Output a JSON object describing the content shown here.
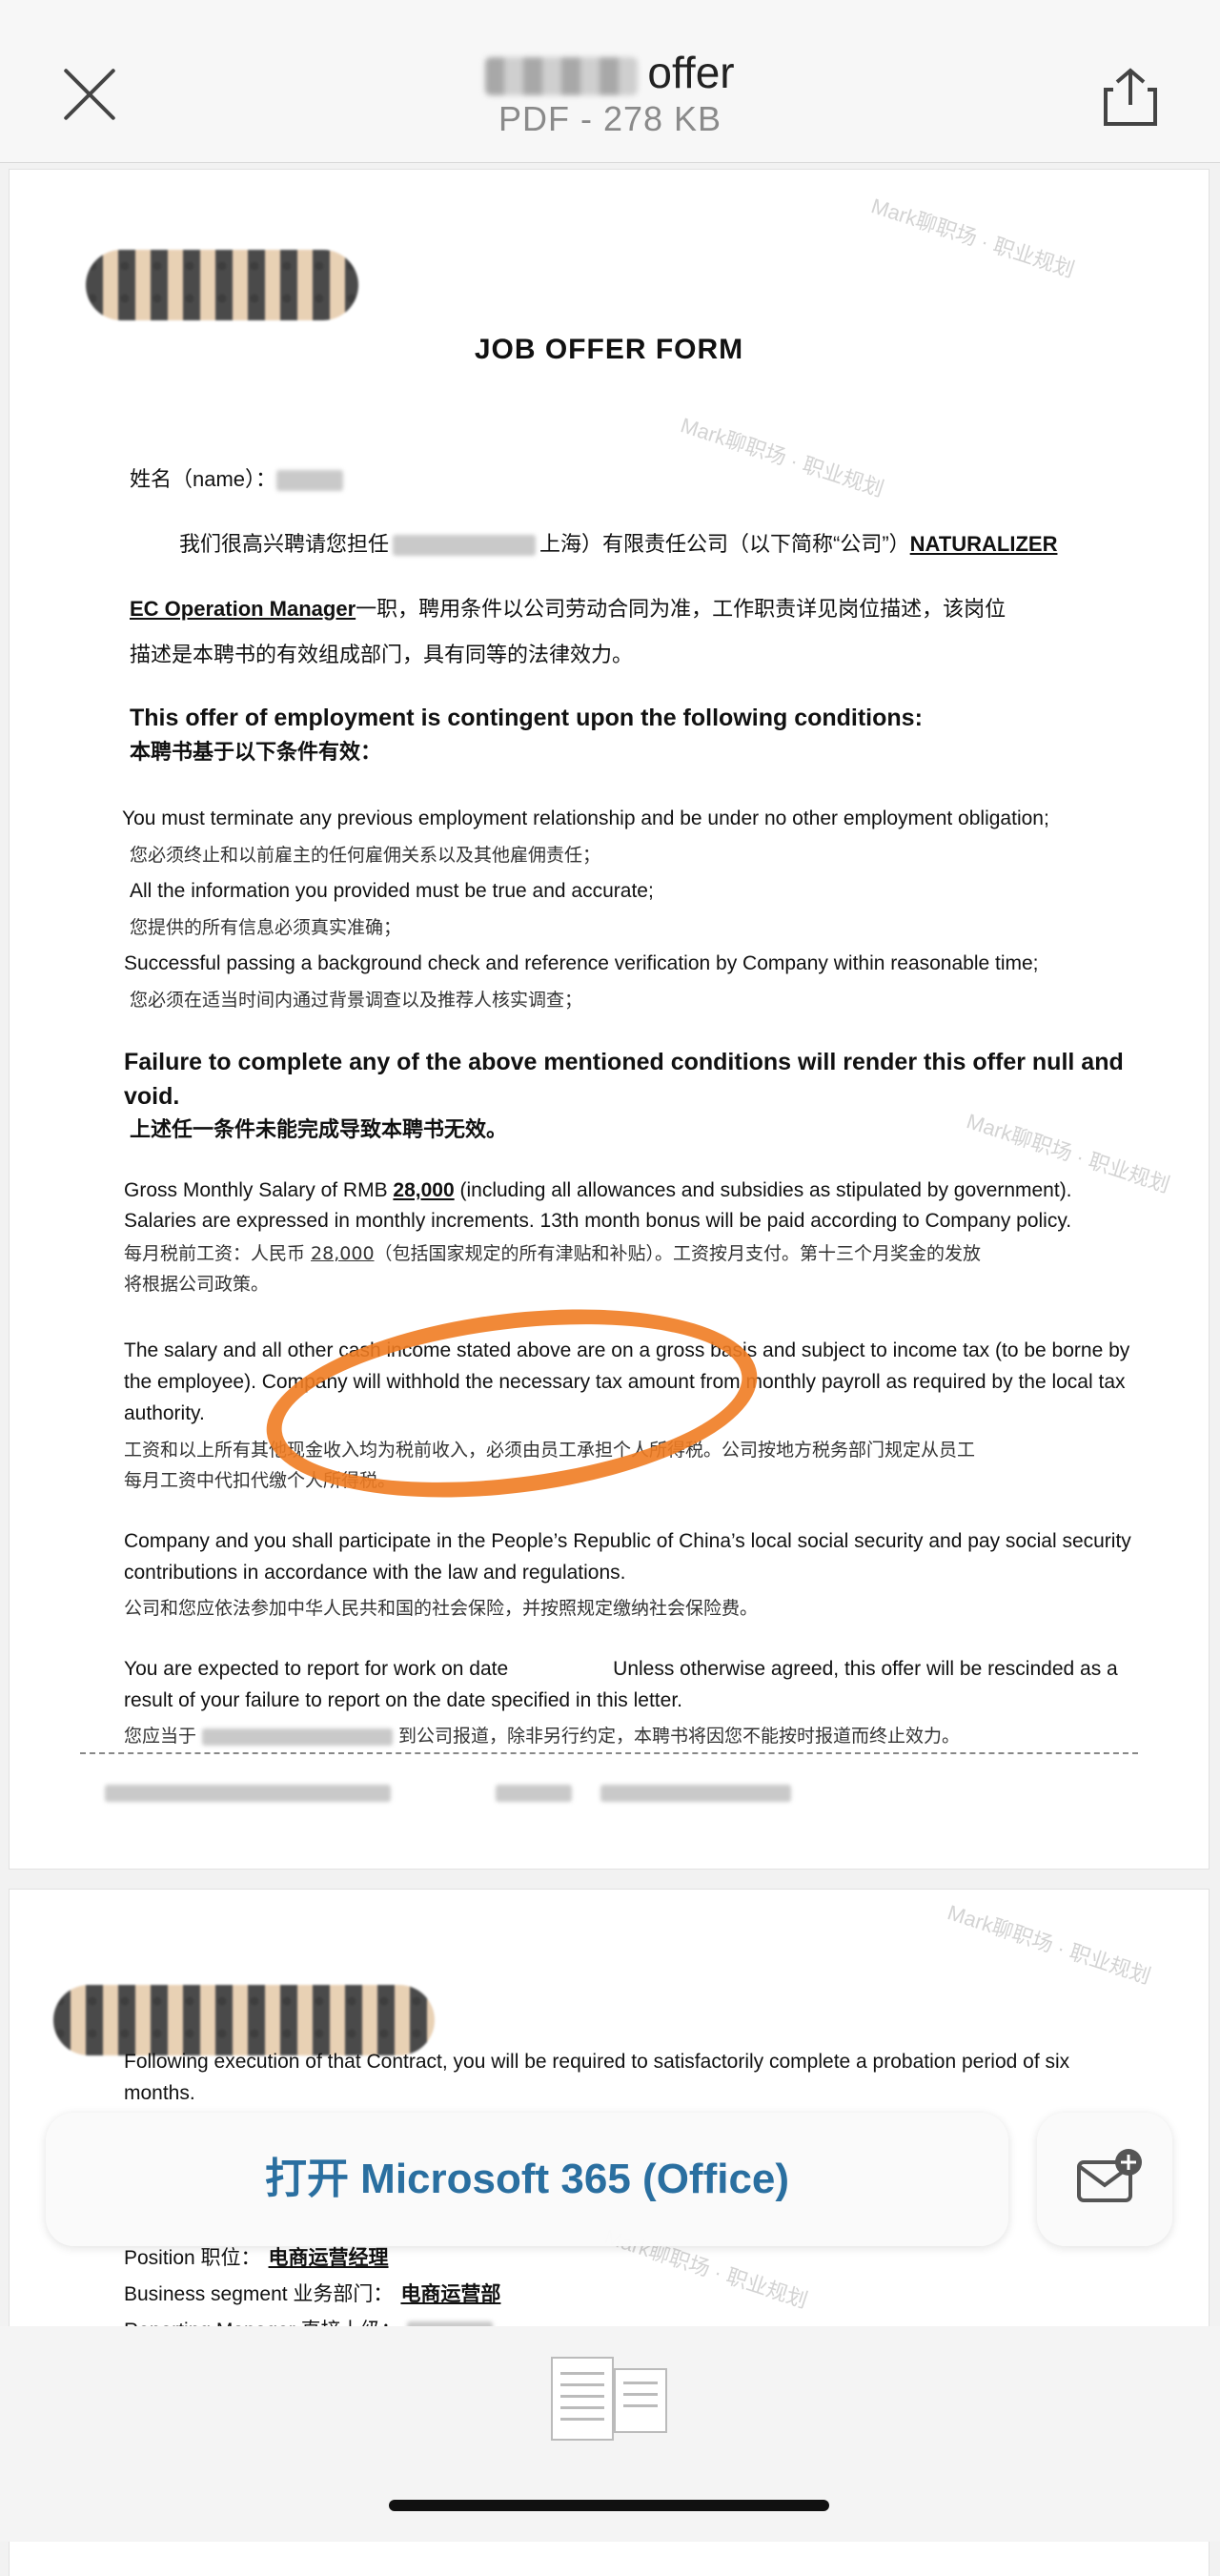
{
  "header": {
    "title": "offer",
    "subtitle": "PDF - 278 KB",
    "close_icon": "close-icon",
    "share_icon": "share-icon"
  },
  "document": {
    "form_title": "JOB OFFER FORM",
    "name_label": "姓名（name）：",
    "intro_line1_a": "我们很高兴聘请您担任",
    "intro_line1_b": "上海）有限责任公司（以下简称“公司”）",
    "brand": "NATURALIZER",
    "position_en": "EC Operation Manager",
    "intro_line2": "一职，聘用条件以公司劳动合同为准，工作职责详见岗位描述，该岗位",
    "intro_line3": "描述是本聘书的有效组成部门，具有同等的法律效力。",
    "conditions_en": "This offer of employment is contingent upon the following conditions:",
    "conditions_cn": "本聘书基于以下条件有效：",
    "cond1_en": "You must terminate any previous employment relationship and be under no other employment obligation;",
    "cond1_cn": "您必须终止和以前雇主的任何雇佣关系以及其他雇佣责任；",
    "cond2_en": "All the information you provided must be true and accurate;",
    "cond2_cn": "您提供的所有信息必须真实准确；",
    "cond3_en": "Successful passing a background check and reference verification by Company within reasonable time;",
    "cond3_cn": "您必须在适当时间内通过背景调查以及推荐人核实调查；",
    "failure_en": "Failure to complete any of the above mentioned conditions will render this offer null and void.",
    "failure_cn": "上述任一条件未能完成导致本聘书无效。",
    "salary_en_a": "Gross Monthly Salary of RMB ",
    "salary_amount": "28,000",
    "salary_en_b": " (including all allowances and subsidies as stipulated by government).",
    "salary_en_line2": "Salaries are expressed in monthly increments. 13th month bonus will be paid according to Company policy.",
    "salary_cn_a": "每月税前工资：人民币 ",
    "salary_cn_b": "（包括国家规定的所有津贴和补贴）。工资按月支付。第十三个月奖金的发放",
    "salary_cn_line2": "将根据公司政策。",
    "tax_en": "The salary and all other cash income stated above are on a gross basis and subject to income tax (to be borne by the employee). Company will withhold the necessary tax amount from monthly payroll as required by the local tax authority.",
    "tax_cn_1": "工资和以上所有其他现金收入均为税前收入，必须由员工承担个人所得税。公司按地方税务部门规定从员工",
    "tax_cn_2": "每月工资中代扣代缴个人所得税。",
    "social_en": "Company and you shall participate in the People’s Republic of China’s local social security and pay social security contributions in accordance with the law and regulations.",
    "social_cn": "公司和您应依法参加中华人民共和国的社会保险，并按照规定缴纳社会保险费。",
    "report_en_a": "You are expected to report for work on date",
    "report_en_b": "Unless otherwise agreed, this offer will be rescinded as a result of your failure to report on the date specified in this letter.",
    "report_cn_a": "您应当于",
    "report_cn_b": "到公司报道，除非另行约定，本聘书将因您不能按时报道而终止效力。",
    "page2_probation": "Following execution of that Contract, you will be required to satisfactorily complete a probation period of six months.",
    "position_label": "Position 职位：",
    "position_value": "电商运营经理",
    "segment_label": "Business segment 业务部门：",
    "segment_value": "电商运营部",
    "manager_label": "Reporting Manager 直接上级：",
    "watermark": "Mark聊职场 · 职业规划"
  },
  "actions": {
    "open_label": "打开 Microsoft 365 (Office)",
    "mail_icon": "mail-add-icon"
  },
  "colors": {
    "accent": "#2a6fa0",
    "highlight": "#f07c22"
  }
}
